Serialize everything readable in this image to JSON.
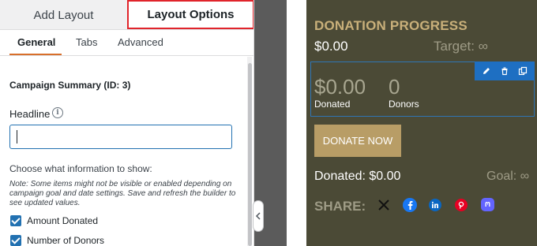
{
  "top_tabs": [
    {
      "label": "Add Layout",
      "active": false
    },
    {
      "label": "Layout Options",
      "active": true
    }
  ],
  "sub_tabs": [
    {
      "label": "General",
      "active": true
    },
    {
      "label": "Tabs",
      "active": false
    },
    {
      "label": "Advanced",
      "active": false
    }
  ],
  "settings": {
    "section_title": "Campaign Summary (ID: 3)",
    "headline_label": "Headline",
    "headline_value": "",
    "choose_label": "Choose what information to show:",
    "note": "Note: Some items might not be visible or enabled depending on campaign goal and date settings. Save and refresh the builder to see updated values.",
    "checkboxes": [
      {
        "label": "Amount Donated",
        "checked": true
      },
      {
        "label": "Number of Donors",
        "checked": true
      }
    ]
  },
  "preview": {
    "title": "DONATION PROGRESS",
    "raised": "$0.00",
    "target": "Target: ∞",
    "summary": {
      "amount": "$0.00",
      "amount_label": "Donated",
      "donors": "0",
      "donors_label": "Donors"
    },
    "donate_button": "DONATE NOW",
    "donated_line": "Donated: $0.00",
    "goal_line": "Goal: ∞",
    "share_label": "SHARE:",
    "social_icons": [
      "x-icon",
      "facebook-icon",
      "linkedin-icon",
      "pinterest-icon",
      "mastodon-icon"
    ]
  },
  "colors": {
    "accent_blue": "#2271b1",
    "active_tab_border": "#e0242b",
    "block_bg": "#4b4a36",
    "title_gold": "#c9b07a",
    "button_gold": "#b89d66",
    "toolbar_blue": "#1e6fc2"
  }
}
